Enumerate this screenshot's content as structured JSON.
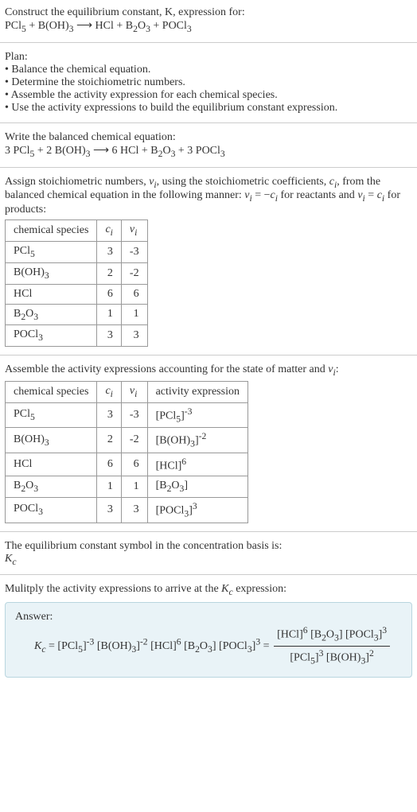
{
  "intro": {
    "l1": "Construct the equilibrium constant, K, expression for:",
    "l2_html": "PCl<sub>5</sub> + B(OH)<sub>3</sub> ⟶ HCl + B<sub>2</sub>O<sub>3</sub> + POCl<sub>3</sub>"
  },
  "plan": {
    "title": "Plan:",
    "b1": "• Balance the chemical equation.",
    "b2": "• Determine the stoichiometric numbers.",
    "b3": "• Assemble the activity expression for each chemical species.",
    "b4": "• Use the activity expressions to build the equilibrium constant expression."
  },
  "balanced": {
    "title": "Write the balanced chemical equation:",
    "eq_html": "3 PCl<sub>5</sub> + 2 B(OH)<sub>3</sub> ⟶ 6 HCl + B<sub>2</sub>O<sub>3</sub> + 3 POCl<sub>3</sub>"
  },
  "stoich": {
    "intro_html": "Assign stoichiometric numbers, <i>ν<sub>i</sub></i>, using the stoichiometric coefficients, <i>c<sub>i</sub></i>, from the balanced chemical equation in the following manner: <i>ν<sub>i</sub></i> = −<i>c<sub>i</sub></i> for reactants and <i>ν<sub>i</sub></i> = <i>c<sub>i</sub></i> for products:",
    "headers": {
      "h1": "chemical species",
      "h2_html": "<i>c<sub>i</sub></i>",
      "h3_html": "<i>ν<sub>i</sub></i>"
    },
    "rows": [
      {
        "sp_html": "PCl<sub>5</sub>",
        "c": "3",
        "v": "-3"
      },
      {
        "sp_html": "B(OH)<sub>3</sub>",
        "c": "2",
        "v": "-2"
      },
      {
        "sp_html": "HCl",
        "c": "6",
        "v": "6"
      },
      {
        "sp_html": "B<sub>2</sub>O<sub>3</sub>",
        "c": "1",
        "v": "1"
      },
      {
        "sp_html": "POCl<sub>3</sub>",
        "c": "3",
        "v": "3"
      }
    ]
  },
  "activity": {
    "intro_html": "Assemble the activity expressions accounting for the state of matter and <i>ν<sub>i</sub></i>:",
    "headers": {
      "h1": "chemical species",
      "h2_html": "<i>c<sub>i</sub></i>",
      "h3_html": "<i>ν<sub>i</sub></i>",
      "h4": "activity expression"
    },
    "rows": [
      {
        "sp_html": "PCl<sub>5</sub>",
        "c": "3",
        "v": "-3",
        "ae_html": "[PCl<sub>5</sub>]<sup>-3</sup>"
      },
      {
        "sp_html": "B(OH)<sub>3</sub>",
        "c": "2",
        "v": "-2",
        "ae_html": "[B(OH)<sub>3</sub>]<sup>-2</sup>"
      },
      {
        "sp_html": "HCl",
        "c": "6",
        "v": "6",
        "ae_html": "[HCl]<sup>6</sup>"
      },
      {
        "sp_html": "B<sub>2</sub>O<sub>3</sub>",
        "c": "1",
        "v": "1",
        "ae_html": "[B<sub>2</sub>O<sub>3</sub>]"
      },
      {
        "sp_html": "POCl<sub>3</sub>",
        "c": "3",
        "v": "3",
        "ae_html": "[POCl<sub>3</sub>]<sup>3</sup>"
      }
    ]
  },
  "kc_symbol": {
    "l1": "The equilibrium constant symbol in the concentration basis is:",
    "l2_html": "<i>K<sub>c</sub></i>"
  },
  "final": {
    "intro_html": "Mulitply the activity expressions to arrive at the <i>K<sub>c</sub></i> expression:",
    "answer_label": "Answer:",
    "lhs_html": "<i>K<sub>c</sub></i> = [PCl<sub>5</sub>]<sup>-3</sup> [B(OH)<sub>3</sub>]<sup>-2</sup> [HCl]<sup>6</sup> [B<sub>2</sub>O<sub>3</sub>] [POCl<sub>3</sub>]<sup>3</sup> = ",
    "frac_num_html": "[HCl]<sup>6</sup> [B<sub>2</sub>O<sub>3</sub>] [POCl<sub>3</sub>]<sup>3</sup>",
    "frac_den_html": "[PCl<sub>5</sub>]<sup>3</sup> [B(OH)<sub>3</sub>]<sup>2</sup>"
  }
}
